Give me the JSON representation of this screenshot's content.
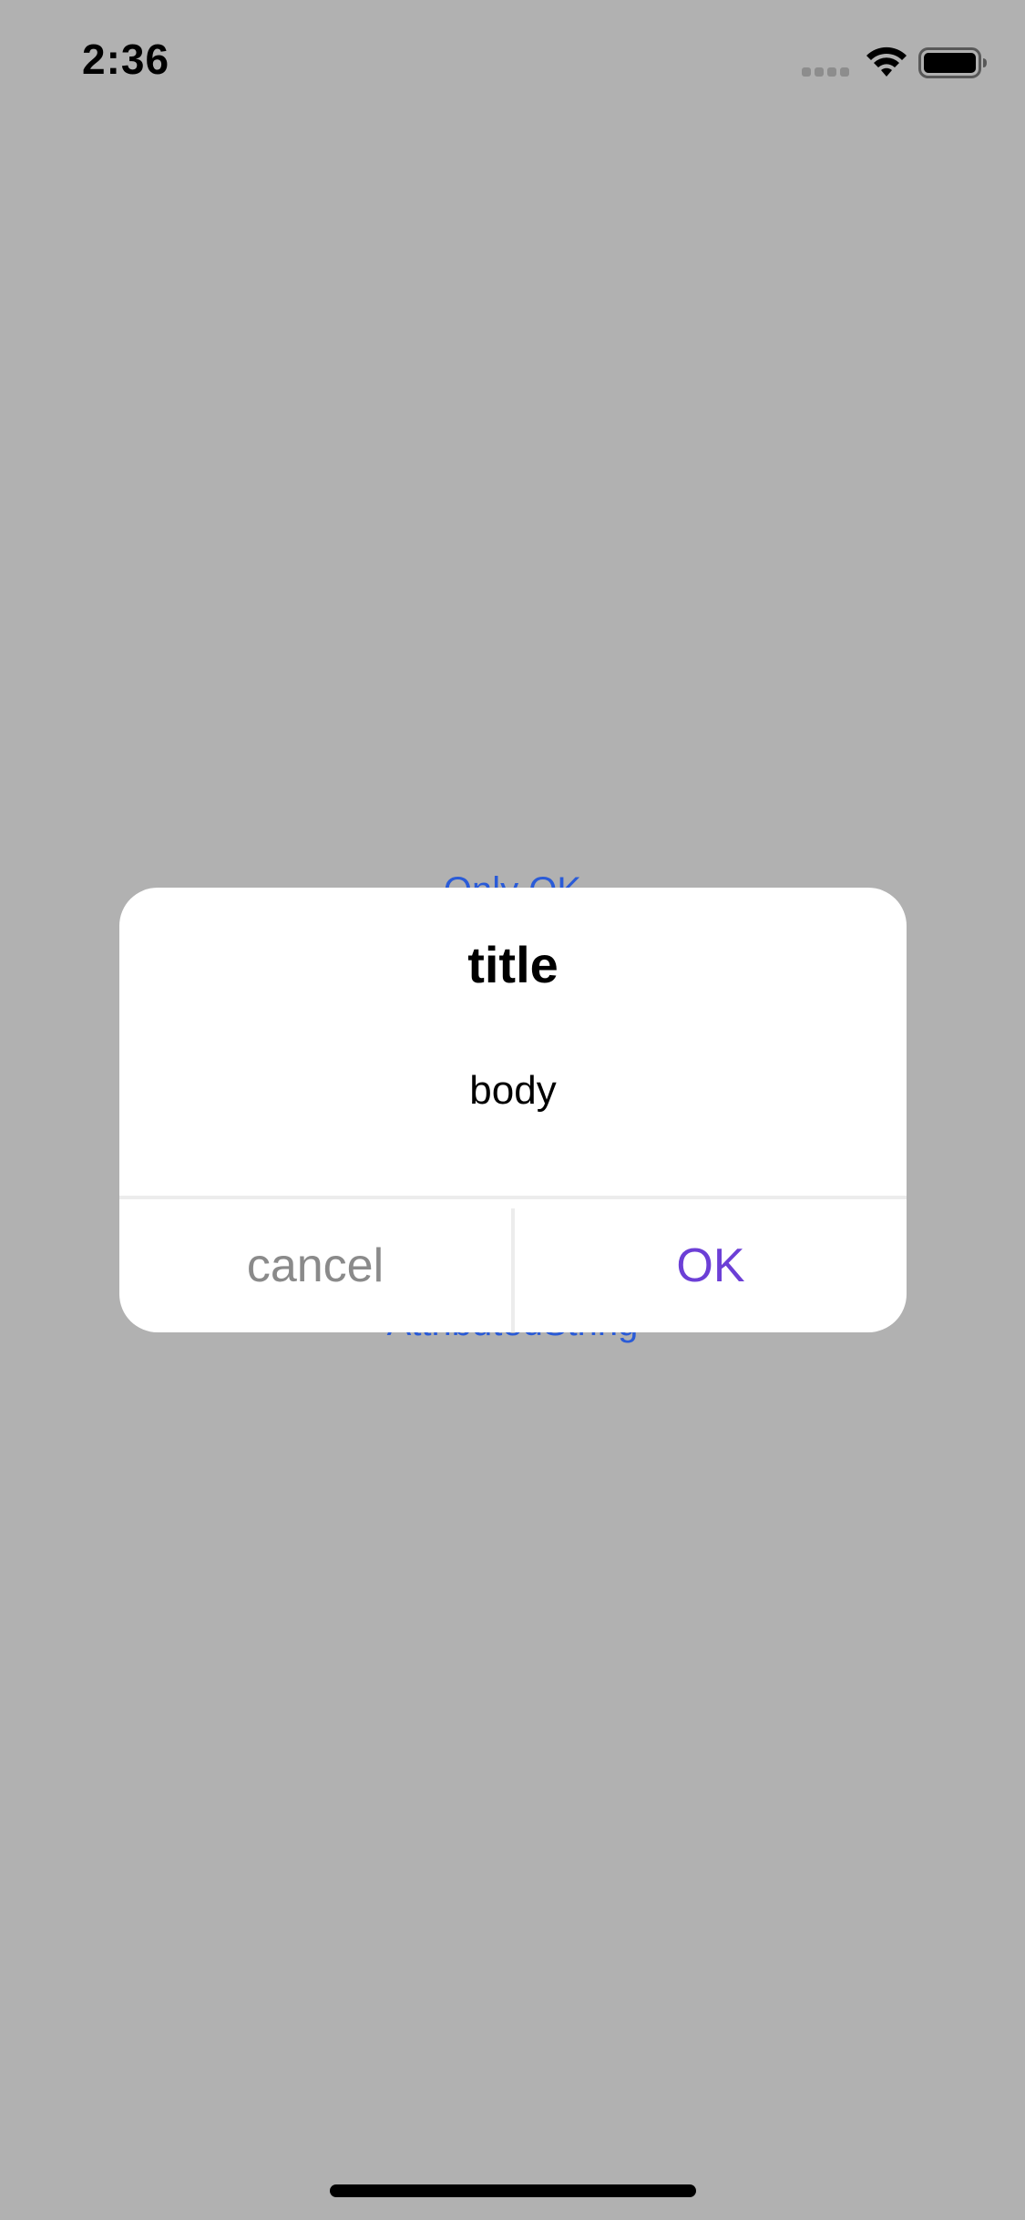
{
  "status_bar": {
    "time": "2:36",
    "signal_icon": "cellular-signal-icon",
    "wifi_icon": "wifi-icon",
    "battery_icon": "battery-icon"
  },
  "background": {
    "top_button_label": "Only OK",
    "bottom_button_label": "AttributedString"
  },
  "dialog": {
    "title": "title",
    "body": "body",
    "cancel_label": "cancel",
    "ok_label": "OK"
  },
  "colors": {
    "background_dim": "#b1b1b1",
    "link_blue": "#2a5bd7",
    "ok_purple": "#6c3fd6",
    "cancel_gray": "#8a8a8a"
  }
}
